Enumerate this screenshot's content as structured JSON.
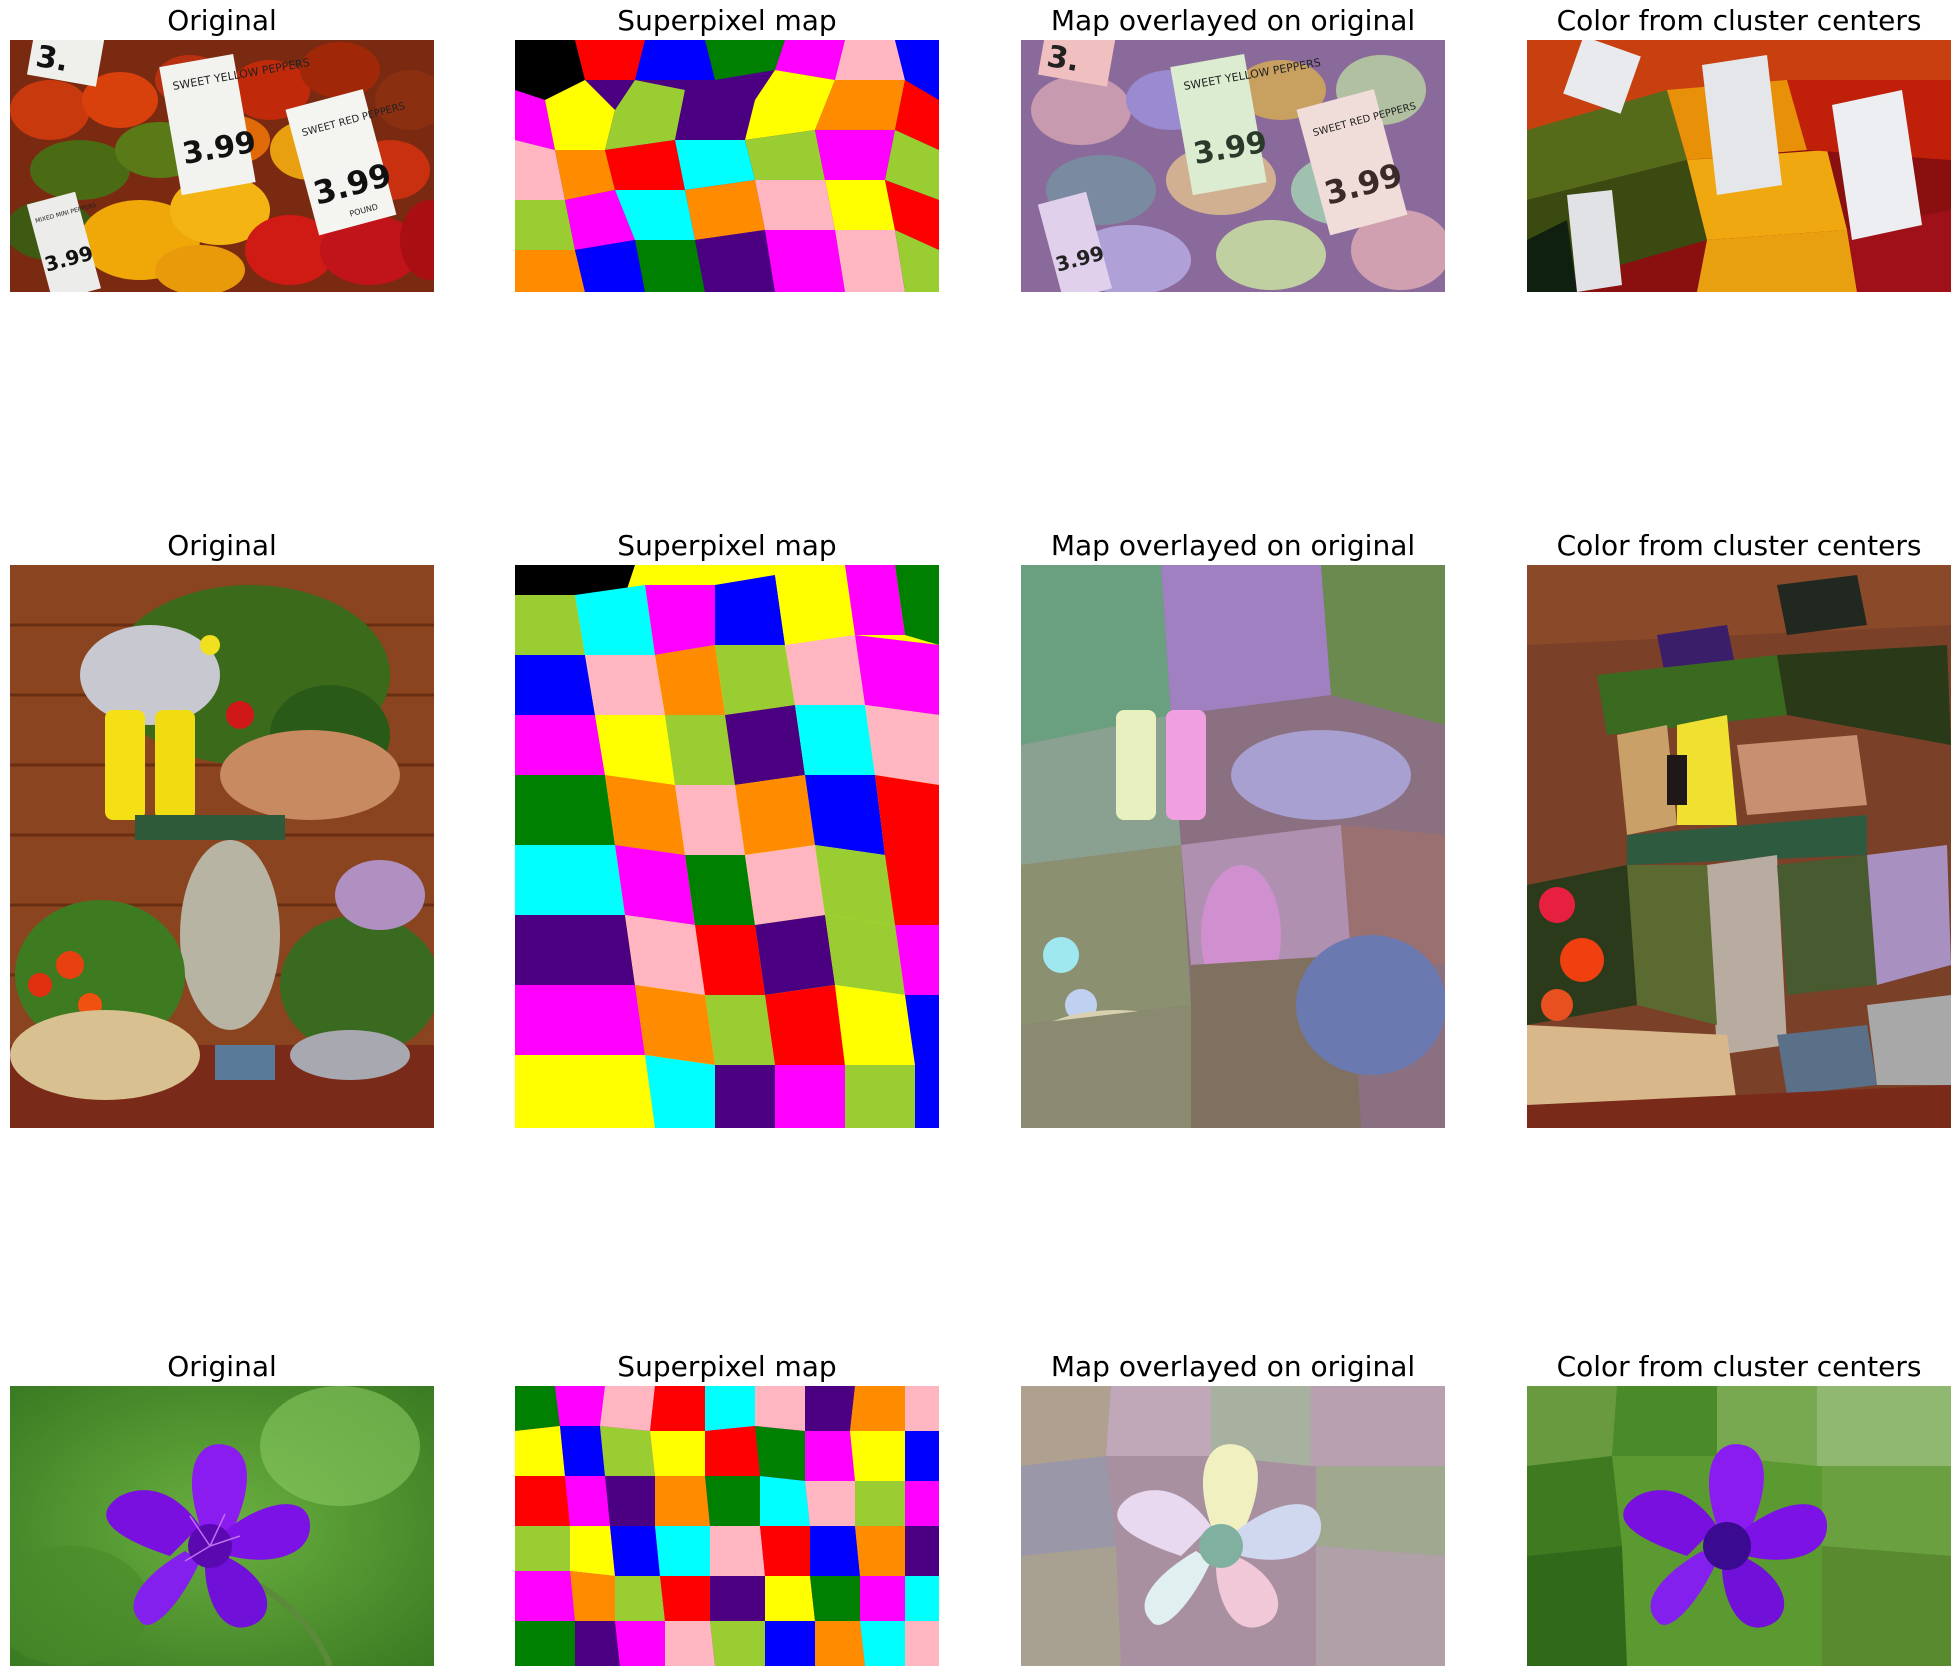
{
  "figure": {
    "rows": [
      {
        "subject": "market peppers with price signs",
        "titles": [
          "Original",
          "Superpixel map",
          "Map overlayed on original",
          "Color from cluster centers"
        ],
        "sign_texts": {
          "sign1": "SWEET YELLOW PEPPERS",
          "sign1_price": "3.99",
          "sign2": "SWEET RED PEPPERS",
          "sign2_price": "3.99",
          "sign2_unit": "POUND",
          "sign3": "MIXED MINI PEPPERS",
          "sign3_price": "3.99",
          "corner_price": "3."
        }
      },
      {
        "subject": "garden boots, basket and rabbit statue",
        "titles": [
          "Original",
          "Superpixel map",
          "Map overlayed on original",
          "Color from cluster centers"
        ]
      },
      {
        "subject": "purple flower",
        "titles": [
          "Original",
          "Superpixel map",
          "Map overlayed on original",
          "Color from cluster centers"
        ]
      }
    ],
    "palette": [
      "#ff00ff",
      "#0000ff",
      "#ffff00",
      "#ff0000",
      "#00ffff",
      "#ffb6c1",
      "#ff8c00",
      "#9acd32",
      "#008000",
      "#4b0082"
    ]
  }
}
